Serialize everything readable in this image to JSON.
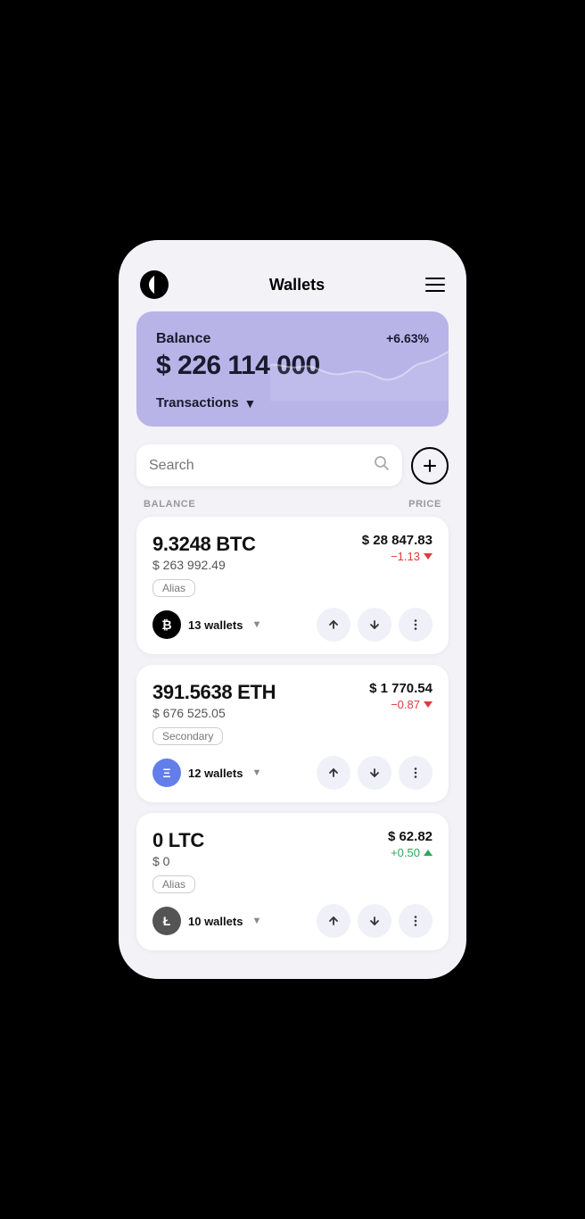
{
  "header": {
    "title": "Wallets",
    "menu_label": "menu"
  },
  "balance_card": {
    "balance_label": "Balance",
    "balance_percent": "+6.63%",
    "balance_amount": "$ 226 114 000",
    "transactions_label": "Transactions"
  },
  "search": {
    "placeholder": "Search"
  },
  "columns": {
    "balance": "BALANCE",
    "price": "PRICE"
  },
  "wallets": [
    {
      "amount": "9.3248 BTC",
      "usd": "$ 263 992.49",
      "tag": "Alias",
      "price": "$ 28 847.83",
      "change": "−1.13",
      "change_type": "negative",
      "wallets_count": "13 wallets",
      "crypto_symbol": "₿",
      "logo_type": "btc"
    },
    {
      "amount": "391.5638 ETH",
      "usd": "$ 676 525.05",
      "tag": "Secondary",
      "price": "$ 1 770.54",
      "change": "−0.87",
      "change_type": "negative",
      "wallets_count": "12 wallets",
      "crypto_symbol": "Ξ",
      "logo_type": "eth"
    },
    {
      "amount": "0 LTC",
      "usd": "$ 0",
      "tag": "Alias",
      "price": "$ 62.82",
      "change": "+0.50",
      "change_type": "positive",
      "wallets_count": "10 wallets",
      "crypto_symbol": "Ł",
      "logo_type": "ltc"
    }
  ],
  "buttons": {
    "add": "+",
    "send": "send",
    "receive": "receive",
    "more": "more"
  }
}
